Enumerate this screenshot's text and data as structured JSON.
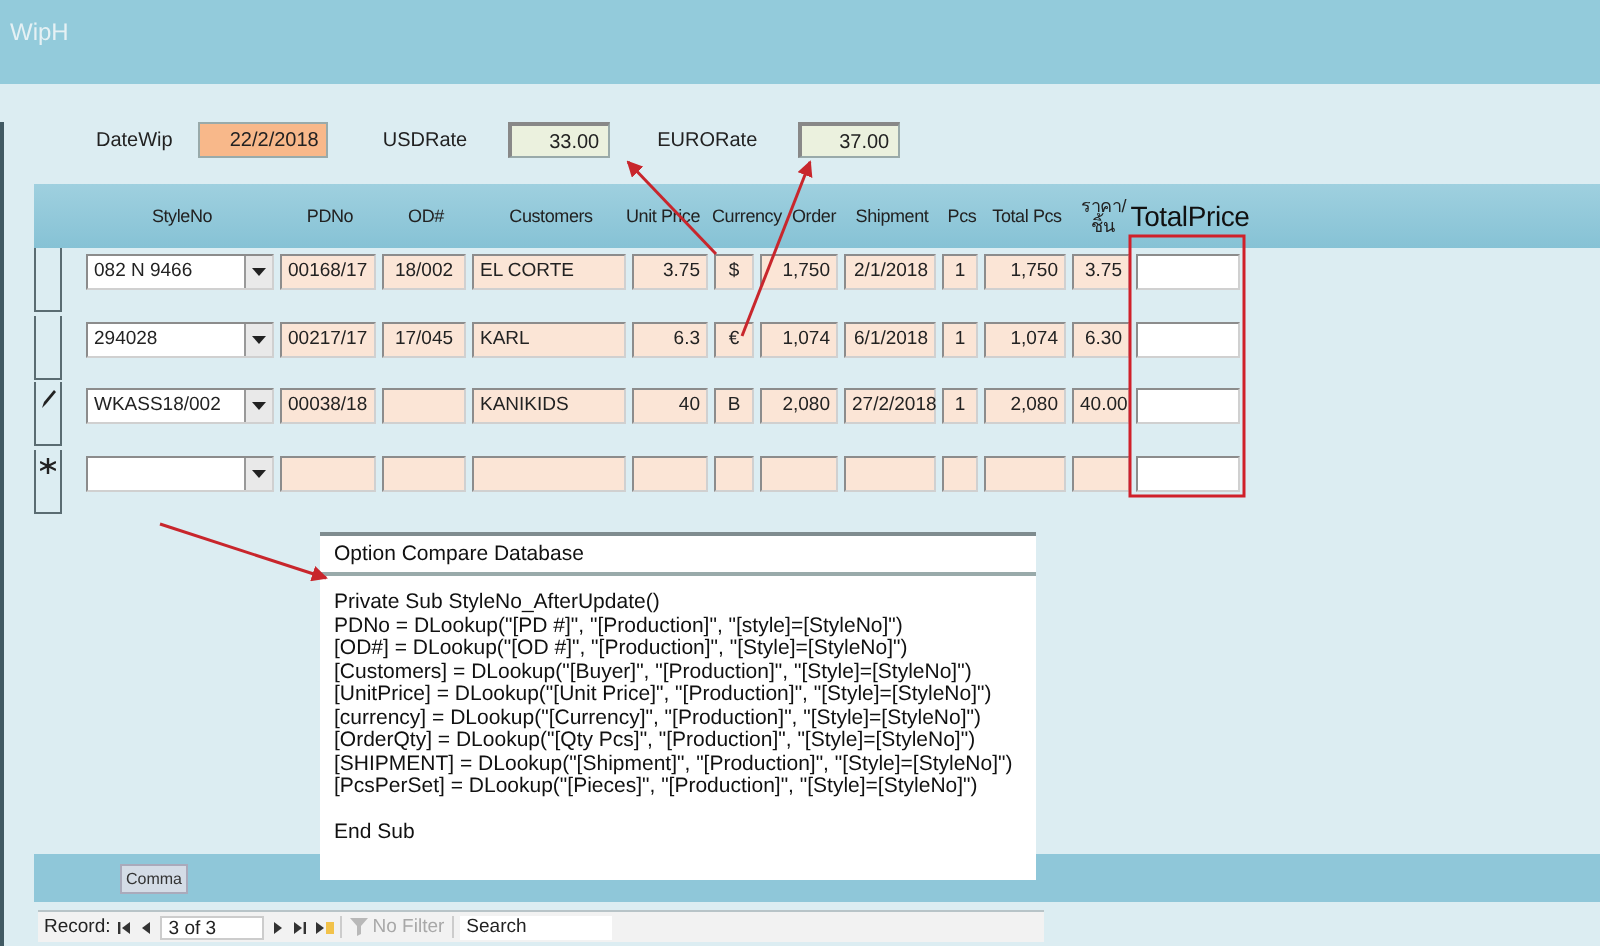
{
  "window": {
    "title": "WipH"
  },
  "header_fields": [
    {
      "label": "DateWip",
      "value": "22/2/2018",
      "kind": "date"
    },
    {
      "label": "USDRate",
      "value": "33.00",
      "kind": "rate"
    },
    {
      "label": "EURORate",
      "value": "37.00",
      "kind": "rate"
    }
  ],
  "table": {
    "columns": [
      {
        "label": "StyleNo",
        "kind": "combo"
      },
      {
        "label": "PDNo",
        "kind": "text"
      },
      {
        "label": "OD#",
        "kind": "center"
      },
      {
        "label": "Customers",
        "kind": "text"
      },
      {
        "label": "Unit Price",
        "kind": "number"
      },
      {
        "label": "Currency",
        "kind": "center"
      },
      {
        "label": "Order",
        "kind": "number"
      },
      {
        "label": "Shipment",
        "kind": "number"
      },
      {
        "label": "Pcs",
        "kind": "center"
      },
      {
        "label": "Total Pcs",
        "kind": "number"
      },
      {
        "label": "ราคา/ชิ้น",
        "kind": "number"
      },
      {
        "label": "TotalPrice",
        "kind": "input"
      }
    ],
    "rows": [
      {
        "editing": false,
        "new_record": false,
        "cells": [
          "082 N 9466",
          "00168/17",
          "18/002",
          "EL CORTE",
          "3.75",
          "$",
          "1,750",
          "2/1/2018",
          "1",
          "1,750",
          "3.75",
          null
        ]
      },
      {
        "editing": false,
        "new_record": false,
        "cells": [
          "294028",
          "00217/17",
          "17/045",
          "KARL",
          "6.3",
          "€",
          "1,074",
          "6/1/2018",
          "1",
          "1,074",
          "6.30",
          null
        ]
      },
      {
        "editing": true,
        "new_record": false,
        "cells": [
          "WKASS18/002",
          "00038/18",
          null,
          "KANIKIDS",
          "40",
          "B",
          "2,080",
          "27/2/2018",
          "1",
          "2,080",
          "40.00",
          null
        ]
      },
      {
        "editing": false,
        "new_record": true,
        "cells": [
          null,
          null,
          null,
          null,
          null,
          null,
          null,
          null,
          null,
          null,
          null,
          null
        ]
      }
    ]
  },
  "footer_button": "Comma",
  "code_popup": {
    "header": "Option Compare Database",
    "lines": [
      "Private Sub StyleNo_AfterUpdate()",
      "PDNo = DLookup(\"[PD #]\", \"[Production]\", \"[style]=[StyleNo]\")",
      "[OD#] = DLookup(\"[OD #]\", \"[Production]\", \"[Style]=[StyleNo]\")",
      "[Customers] = DLookup(\"[Buyer]\", \"[Production]\", \"[Style]=[StyleNo]\")",
      "[UnitPrice] = DLookup(\"[Unit Price]\", \"[Production]\", \"[Style]=[StyleNo]\")",
      "[currency] = DLookup(\"[Currency]\", \"[Production]\", \"[Style]=[StyleNo]\")",
      "[OrderQty] = DLookup(\"[Qty Pcs]\", \"[Production]\", \"[Style]=[StyleNo]\")",
      "[SHIPMENT] = DLookup(\"[Shipment]\", \"[Production]\", \"[Style]=[StyleNo]\")",
      "[PcsPerSet] = DLookup(\"[Pieces]\", \"[Production]\", \"[Style]=[StyleNo]\")"
    ],
    "closing_line": "End Sub"
  },
  "record_nav": {
    "label": "Record:",
    "position": "3 of 3",
    "filter": {
      "label": "No Filter",
      "disabled": true
    },
    "search": {
      "placeholder": "Search"
    }
  }
}
